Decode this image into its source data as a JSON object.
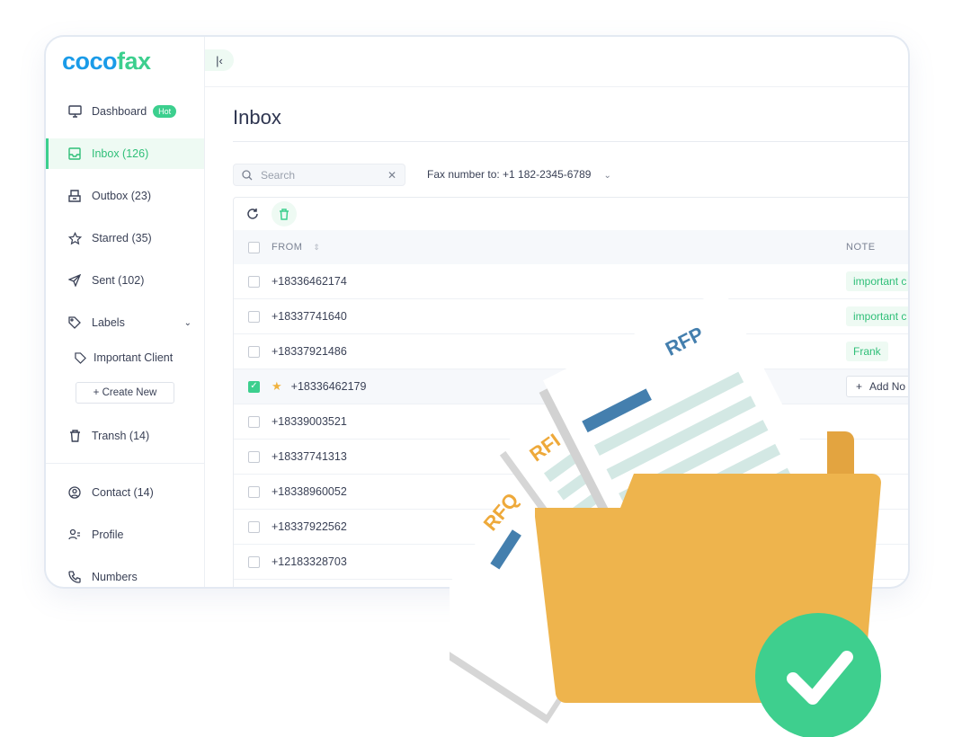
{
  "app": {
    "logo_part1": "coco",
    "logo_part2": "fax",
    "colors": {
      "accent": "#3ccf8e",
      "brand_blue": "#1a9be8",
      "folder": "#eeb44d"
    }
  },
  "sidebar": {
    "items": [
      {
        "label": "Dashboard",
        "badge": "Hot",
        "icon": "monitor-icon"
      },
      {
        "label": "Inbox  (126)",
        "icon": "inbox-icon",
        "active": true
      },
      {
        "label": "Outbox  (23)",
        "icon": "outbox-icon"
      },
      {
        "label": "Starred  (35)",
        "icon": "star-icon"
      },
      {
        "label": "Sent  (102)",
        "icon": "send-icon"
      },
      {
        "label": "Labels",
        "icon": "tag-icon"
      },
      {
        "label": "Important Client",
        "icon": "tag-icon"
      },
      {
        "label": "Transh  (14)",
        "icon": "trash-icon"
      },
      {
        "label": "Contact  (14)",
        "icon": "user-circle-icon"
      },
      {
        "label": "Profile",
        "icon": "profile-icon"
      },
      {
        "label": "Numbers",
        "icon": "phone-icon"
      }
    ],
    "create_new": "+  Create New"
  },
  "main": {
    "title": "Inbox",
    "search_placeholder": "Search",
    "fax_filter": "Fax number to: +1 182-2345-6789",
    "columns": {
      "from": "FROM",
      "note": "NOTE"
    },
    "rows": [
      {
        "from": "+18336462174",
        "note": "important c"
      },
      {
        "from": "+18337741640",
        "note": "important c"
      },
      {
        "from": "+18337921486",
        "note": "Frank"
      },
      {
        "from": "+18336462179",
        "starred": true,
        "checked": true,
        "add_note": "Add No"
      },
      {
        "from": "+18339003521"
      },
      {
        "from": "+18337741313"
      },
      {
        "from": "+18338960052"
      },
      {
        "from": "+18337922562"
      },
      {
        "from": "+12183328703"
      }
    ]
  },
  "illustration": {
    "doc1": "RFP",
    "doc2": "RFI",
    "doc3": "RFQ"
  }
}
